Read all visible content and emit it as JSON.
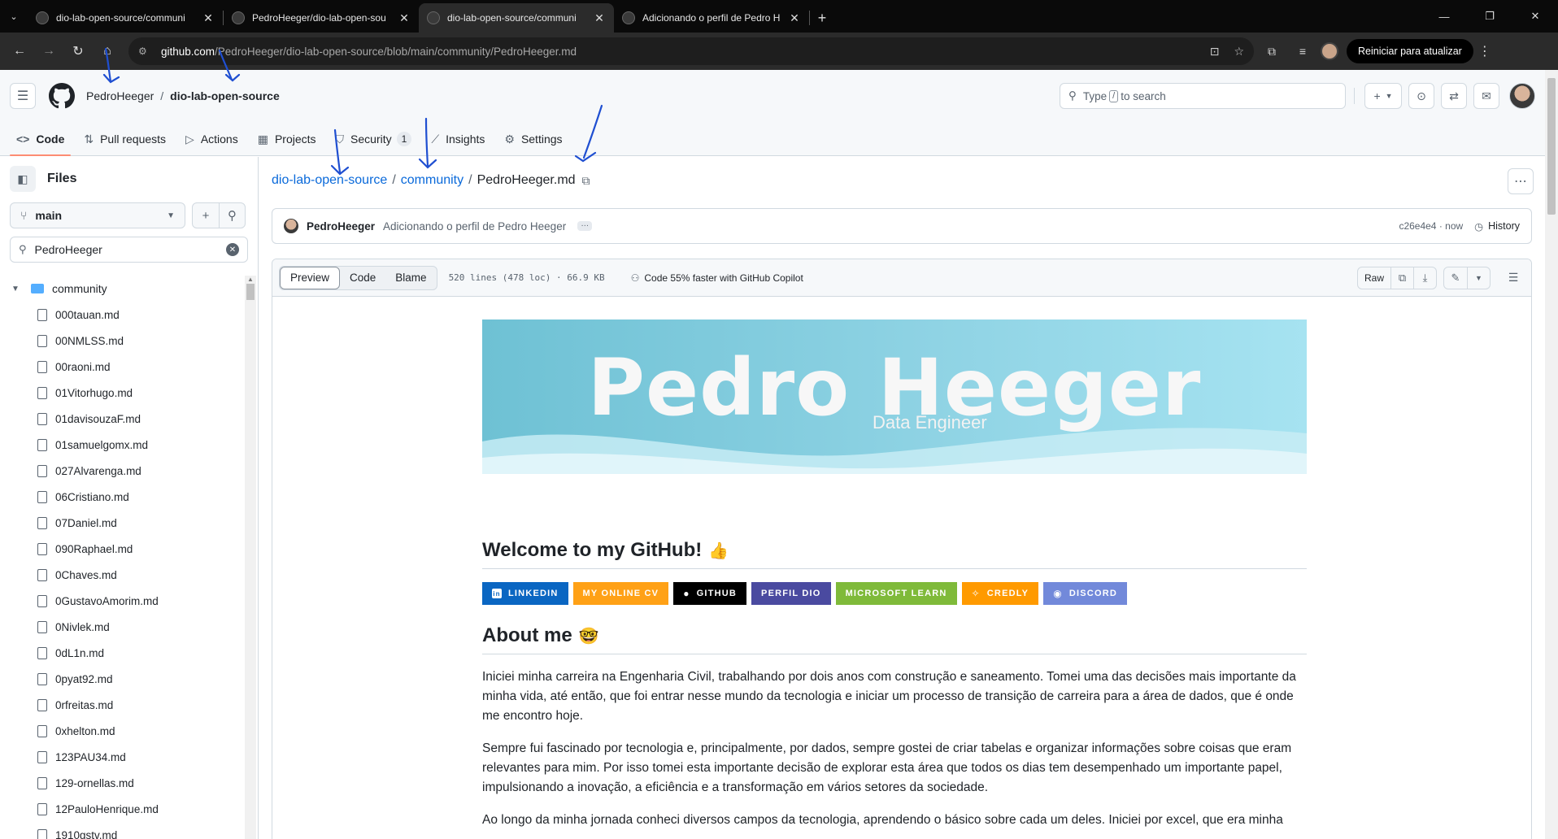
{
  "browser": {
    "tabs": [
      {
        "title": "dio-lab-open-source/communi",
        "active": false
      },
      {
        "title": "PedroHeeger/dio-lab-open-sou",
        "active": false
      },
      {
        "title": "dio-lab-open-source/communi",
        "active": true
      },
      {
        "title": "Adicionando o perfil de Pedro H",
        "active": false
      }
    ],
    "url_host": "github.com",
    "url_path": "/PedroHeeger/dio-lab-open-source/blob/main/community/PedroHeeger.md",
    "update_button": "Reiniciar para atualizar"
  },
  "header": {
    "owner": "PedroHeeger",
    "repo": "dio-lab-open-source",
    "search_pre": "Type",
    "search_key": "/",
    "search_post": "to search"
  },
  "reponav": [
    {
      "label": "Code",
      "icon": "code-icon"
    },
    {
      "label": "Pull requests",
      "icon": "pull-request-icon"
    },
    {
      "label": "Actions",
      "icon": "play-icon"
    },
    {
      "label": "Projects",
      "icon": "table-icon"
    },
    {
      "label": "Security",
      "icon": "shield-icon",
      "counter": "1"
    },
    {
      "label": "Insights",
      "icon": "graph-icon"
    },
    {
      "label": "Settings",
      "icon": "gear-icon"
    }
  ],
  "files_panel": {
    "title": "Files",
    "branch": "main",
    "filter_value": "PedroHeeger",
    "folder": "community",
    "files": [
      "000tauan.md",
      "00NMLSS.md",
      "00raoni.md",
      "01Vitorhugo.md",
      "01davisouzaF.md",
      "01samuelgomx.md",
      "027Alvarenga.md",
      "06Cristiano.md",
      "07Daniel.md",
      "090Raphael.md",
      "0Chaves.md",
      "0GustavoAmorim.md",
      "0Nivlek.md",
      "0dL1n.md",
      "0pyat92.md",
      "0rfreitas.md",
      "0xhelton.md",
      "123PAU34.md",
      "129-ornellas.md",
      "12PauloHenrique.md",
      "1910gstv.md"
    ]
  },
  "breadcrumb": {
    "repo": "dio-lab-open-source",
    "folder": "community",
    "file": "PedroHeeger.md"
  },
  "commit": {
    "author": "PedroHeeger",
    "message": "Adicionando o perfil de Pedro Heeger",
    "sha": "c26e4e4 · now",
    "history": "History"
  },
  "file_header": {
    "tabs": [
      "Preview",
      "Code",
      "Blame"
    ],
    "meta": "520 lines (478 loc) · 66.9 KB",
    "copilot": "Code 55% faster with GitHub Copilot",
    "raw": "Raw"
  },
  "readme": {
    "banner_name": "Pedro Heeger",
    "banner_role": "Data Engineer",
    "welcome": "Welcome to my GitHub!",
    "badges": [
      {
        "label": "LINKEDIN",
        "color": "#0a66c2",
        "icon": "in"
      },
      {
        "label": "MY ONLINE CV",
        "color": "#ffa116",
        "icon": ""
      },
      {
        "label": "GITHUB",
        "color": "#000000",
        "icon": "github"
      },
      {
        "label": "PERFIL DIO",
        "color": "#4a4aa0",
        "icon": ""
      },
      {
        "label": "MICROSOFT LEARN",
        "color": "#7fba3a",
        "icon": ""
      },
      {
        "label": "CREDLY",
        "color": "#ff9a00",
        "icon": "credly"
      },
      {
        "label": "DISCORD",
        "color": "#7289da",
        "icon": "discord"
      }
    ],
    "about": "About me",
    "paragraphs": [
      "Iniciei minha carreira na Engenharia Civil, trabalhando por dois anos com construção e saneamento. Tomei uma das decisões mais importante da minha vida, até então, que foi entrar nesse mundo da tecnologia e iniciar um processo de transição de carreira para a área de dados, que é onde me encontro hoje.",
      "Sempre fui fascinado por tecnologia e, principalmente, por dados, sempre gostei de criar tabelas e organizar informações sobre coisas que eram relevantes para mim. Por isso tomei esta importante decisão de explorar esta área que todos os dias tem desempenhado um importante papel, impulsionando a inovação, a eficiência e a transformação em vários setores da sociedade.",
      "Ao longo da minha jornada conheci diversos campos da tecnologia, aprendendo o básico sobre cada um deles. Iniciei por excel, que era minha"
    ]
  }
}
